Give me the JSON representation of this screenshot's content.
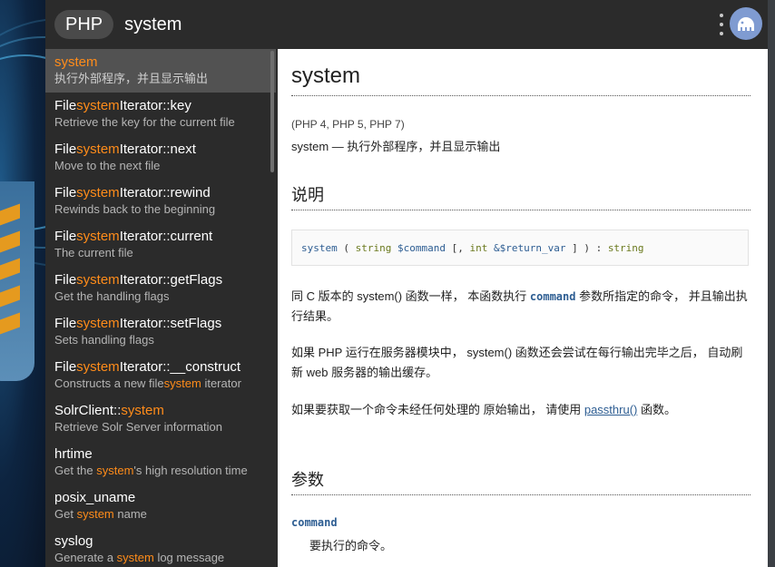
{
  "header": {
    "scope_label": "PHP",
    "query": "system"
  },
  "sidebar": {
    "items": [
      {
        "title_pre": "",
        "title_hl": "system",
        "title_post": "",
        "desc_pre": "执行外部程序，并且显示输出",
        "desc_hl": "",
        "desc_post": "",
        "selected": true
      },
      {
        "title_pre": "File",
        "title_hl": "system",
        "title_post": "Iterator::key",
        "desc_pre": "Retrieve the key for the current file",
        "desc_hl": "",
        "desc_post": ""
      },
      {
        "title_pre": "File",
        "title_hl": "system",
        "title_post": "Iterator::next",
        "desc_pre": "Move to the next file",
        "desc_hl": "",
        "desc_post": ""
      },
      {
        "title_pre": "File",
        "title_hl": "system",
        "title_post": "Iterator::rewind",
        "desc_pre": "Rewinds back to the beginning",
        "desc_hl": "",
        "desc_post": ""
      },
      {
        "title_pre": "File",
        "title_hl": "system",
        "title_post": "Iterator::current",
        "desc_pre": "The current file",
        "desc_hl": "",
        "desc_post": ""
      },
      {
        "title_pre": "File",
        "title_hl": "system",
        "title_post": "Iterator::getFlags",
        "desc_pre": "Get the handling flags",
        "desc_hl": "",
        "desc_post": ""
      },
      {
        "title_pre": "File",
        "title_hl": "system",
        "title_post": "Iterator::setFlags",
        "desc_pre": "Sets handling flags",
        "desc_hl": "",
        "desc_post": ""
      },
      {
        "title_pre": "File",
        "title_hl": "system",
        "title_post": "Iterator::__construct",
        "desc_pre": "Constructs a new file",
        "desc_hl": "system",
        "desc_post": " iterator"
      },
      {
        "title_pre": "SolrClient::",
        "title_hl": "system",
        "title_post": "",
        "desc_pre": "Retrieve Solr Server information",
        "desc_hl": "",
        "desc_post": ""
      },
      {
        "title_pre": "hrtime",
        "title_hl": "",
        "title_post": "",
        "desc_pre": "Get the ",
        "desc_hl": "system",
        "desc_post": "'s high resolution time"
      },
      {
        "title_pre": "posix_uname",
        "title_hl": "",
        "title_post": "",
        "desc_pre": "Get ",
        "desc_hl": "system",
        "desc_post": " name"
      },
      {
        "title_pre": "syslog",
        "title_hl": "",
        "title_post": "",
        "desc_pre": "Generate a ",
        "desc_hl": "system",
        "desc_post": " log message"
      }
    ]
  },
  "doc": {
    "title": "system",
    "versions": "(PHP 4, PHP 5, PHP 7)",
    "summary": "system — 执行外部程序，并且显示输出",
    "section_description": "说明",
    "signature": {
      "fn": "system",
      "open": " ( ",
      "type1": "string",
      "param1": " $command",
      "opt_open": " [, ",
      "type2": "int",
      "param2": " &$return_var",
      "close": " ] ) : ",
      "ret": "string"
    },
    "para1_a": "同 C 版本的 system() 函数一样， 本函数执行 ",
    "para1_kw": "command",
    "para1_b": " 参数所指定的命令， 并且输出执行结果。",
    "para2": "如果 PHP 运行在服务器模块中， system() 函数还会尝试在每行输出完毕之后， 自动刷新 web 服务器的输出缓存。",
    "para3_a": "如果要获取一个命令未经任何处理的 原始输出， 请使用 ",
    "para3_link": "passthru()",
    "para3_b": " 函数。",
    "section_params": "参数",
    "param_name": "command",
    "param_desc": "要执行的命令。"
  },
  "icons": {
    "menu": "kebab-menu-icon",
    "avatar": "elephant-avatar-icon"
  },
  "colors": {
    "highlight": "#ff8c1a",
    "sidebar_bg": "#2b2b2b",
    "selected_bg": "#525252",
    "link": "#2d5d92"
  }
}
